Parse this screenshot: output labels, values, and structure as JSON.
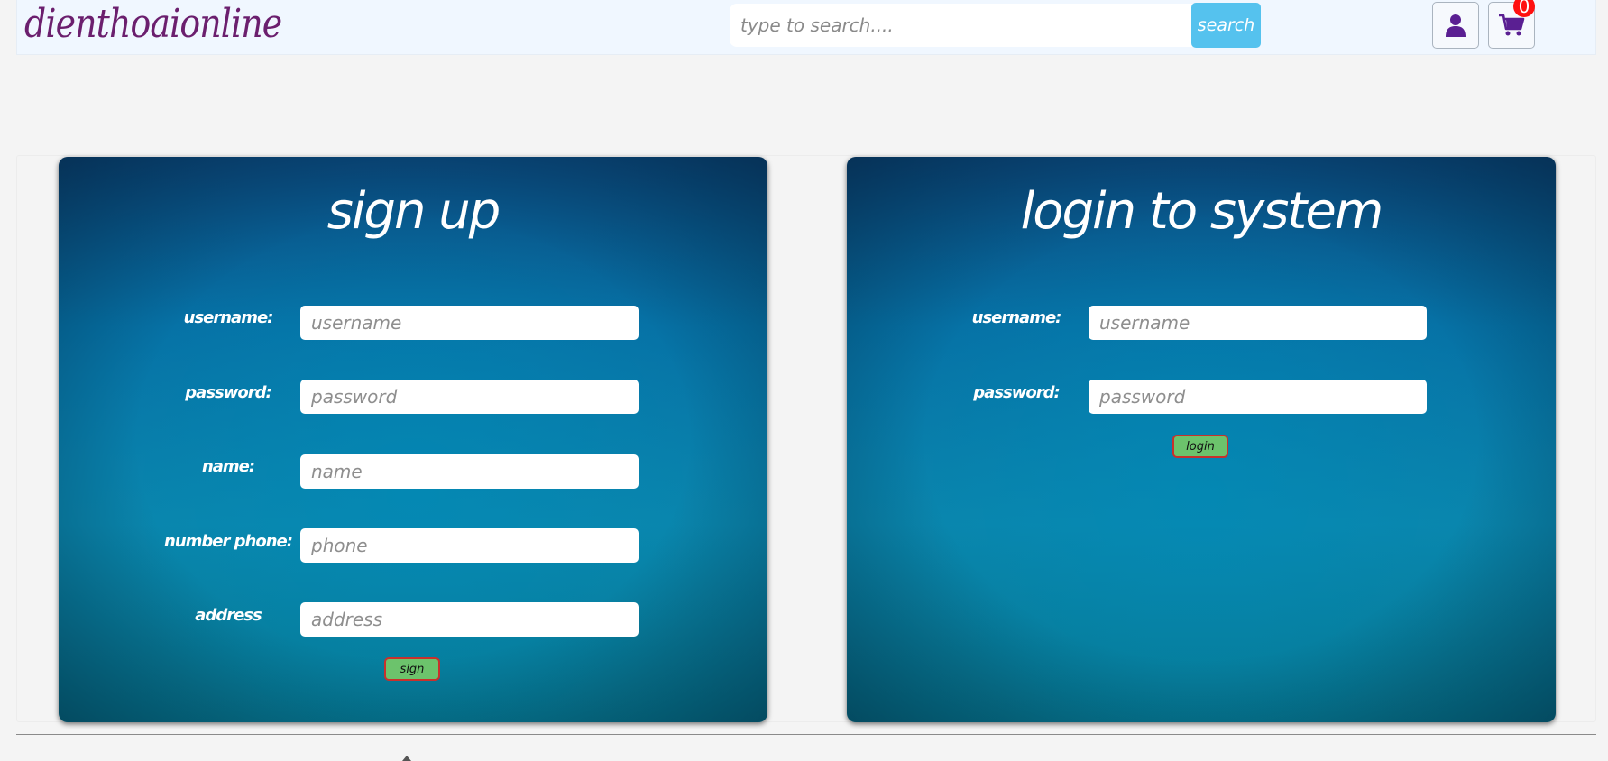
{
  "header": {
    "logo": "dienthoaionline",
    "search": {
      "placeholder": "type to search....",
      "button_label": "search"
    },
    "user_icon": "user-icon",
    "cart_icon": "cart-icon",
    "cart_count": "0",
    "accent_color": "#55c2ee",
    "badge_color": "#ff1010"
  },
  "signup": {
    "title": "sign up",
    "fields": [
      {
        "label": "username:",
        "placeholder": "username"
      },
      {
        "label": "password:",
        "placeholder": "password"
      },
      {
        "label": "name:",
        "placeholder": "name"
      },
      {
        "label": "number phone:",
        "placeholder": "phone"
      },
      {
        "label": "address",
        "placeholder": "address"
      }
    ],
    "button_label": "sign"
  },
  "login": {
    "title": "login to system",
    "fields": [
      {
        "label": "username:",
        "placeholder": "username"
      },
      {
        "label": "password:",
        "placeholder": "password"
      }
    ],
    "button_label": "login"
  }
}
